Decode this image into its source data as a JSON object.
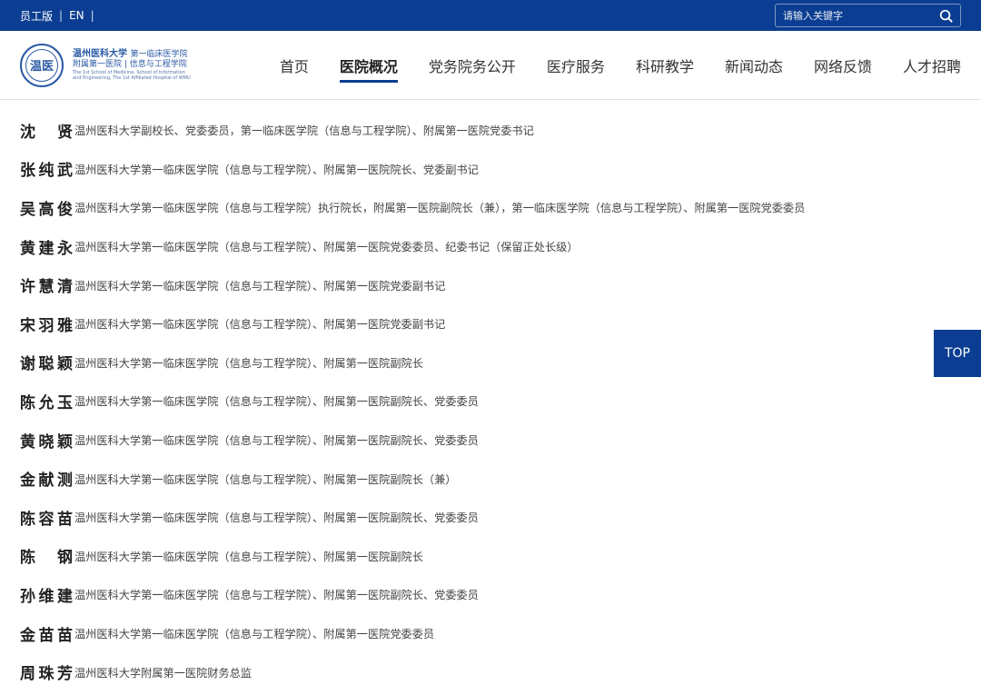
{
  "topbar": {
    "staff_label": "员工版",
    "en_label": "EN",
    "sep": "|",
    "search_placeholder": "请输入关键字"
  },
  "logo": {
    "seal_text": "温医",
    "univ_name": "温州医科大学",
    "school_name": "第一临床医学院",
    "line2": "附属第一医院 | 信息与工程学院",
    "line3": "The 1st School of Medicine, School of Information",
    "line4": "and Engineering, The 1st Affiliated Hospital of WMU"
  },
  "nav": {
    "items": [
      {
        "label": "首页"
      },
      {
        "label": "医院概况"
      },
      {
        "label": "党务院务公开"
      },
      {
        "label": "医疗服务"
      },
      {
        "label": "科研教学"
      },
      {
        "label": "新闻动态"
      },
      {
        "label": "网络反馈"
      },
      {
        "label": "人才招聘"
      }
    ],
    "active_index": 1
  },
  "leaders": [
    {
      "name": "沈贤",
      "title": "温州医科大学副校长、党委委员，第一临床医学院（信息与工程学院）、附属第一医院党委书记"
    },
    {
      "name": "张纯武",
      "title": "温州医科大学第一临床医学院（信息与工程学院）、附属第一医院院长、党委副书记"
    },
    {
      "name": "吴高俊",
      "title": "温州医科大学第一临床医学院（信息与工程学院）执行院长，附属第一医院副院长（兼），第一临床医学院（信息与工程学院）、附属第一医院党委委员"
    },
    {
      "name": "黄建永",
      "title": "温州医科大学第一临床医学院（信息与工程学院）、附属第一医院党委委员、纪委书记（保留正处长级）"
    },
    {
      "name": "许慧清",
      "title": "温州医科大学第一临床医学院（信息与工程学院）、附属第一医院党委副书记"
    },
    {
      "name": "宋羽雅",
      "title": "温州医科大学第一临床医学院（信息与工程学院）、附属第一医院党委副书记"
    },
    {
      "name": "谢聪颖",
      "title": "温州医科大学第一临床医学院（信息与工程学院）、附属第一医院副院长"
    },
    {
      "name": "陈允玉",
      "title": "温州医科大学第一临床医学院（信息与工程学院）、附属第一医院副院长、党委委员"
    },
    {
      "name": "黄晓颖",
      "title": "温州医科大学第一临床医学院（信息与工程学院）、附属第一医院副院长、党委委员"
    },
    {
      "name": "金献测",
      "title": "温州医科大学第一临床医学院（信息与工程学院）、附属第一医院副院长（兼）"
    },
    {
      "name": "陈容苗",
      "title": "温州医科大学第一临床医学院（信息与工程学院）、附属第一医院副院长、党委委员"
    },
    {
      "name": "陈钢",
      "title": "温州医科大学第一临床医学院（信息与工程学院）、附属第一医院副院长"
    },
    {
      "name": "孙维建",
      "title": "温州医科大学第一临床医学院（信息与工程学院）、附属第一医院副院长、党委委员"
    },
    {
      "name": "金苗苗",
      "title": "温州医科大学第一临床医学院（信息与工程学院）、附属第一医院党委委员"
    },
    {
      "name": "周珠芳",
      "title": "温州医科大学附属第一医院财务总监"
    }
  ],
  "top_button": "TOP",
  "colors": {
    "primary": "#0b3e92",
    "logo_blue": "#2b5aa5"
  }
}
